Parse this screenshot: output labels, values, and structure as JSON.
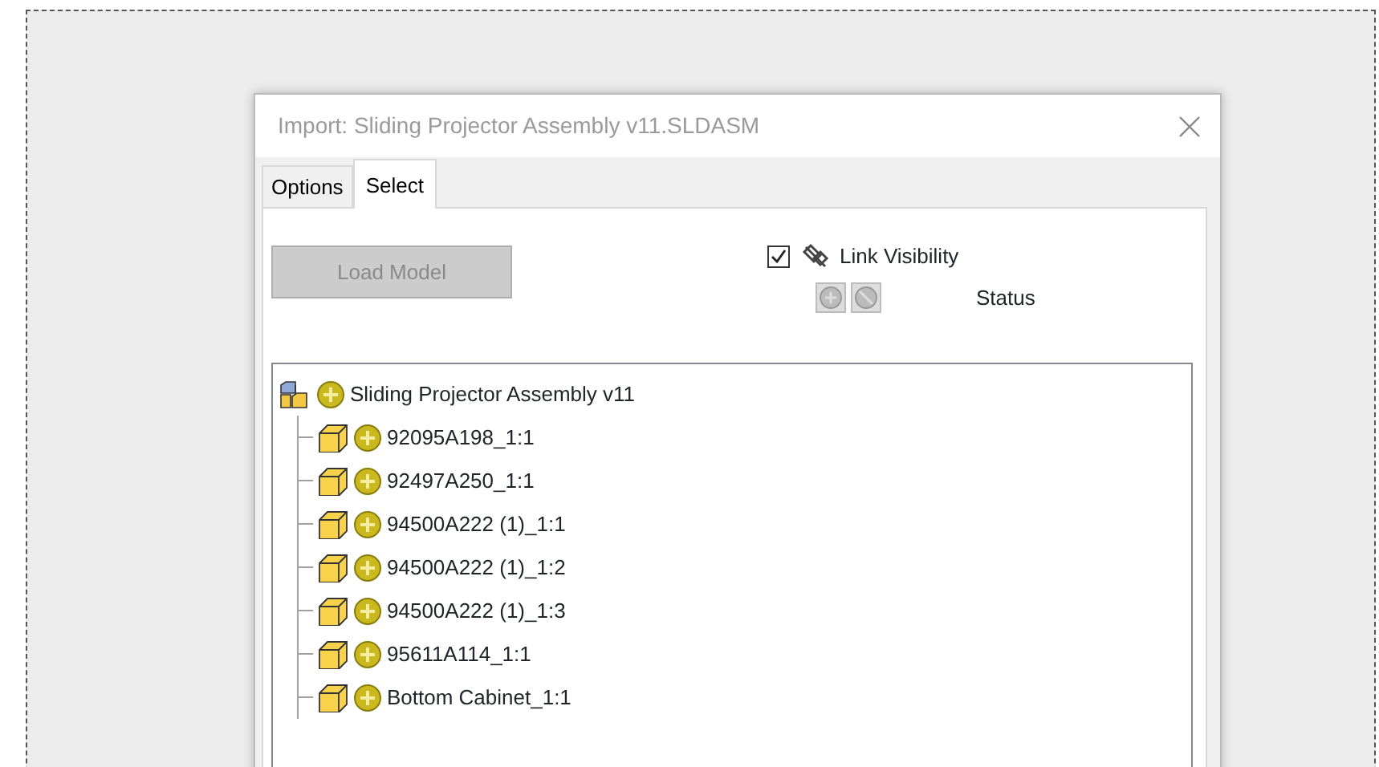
{
  "dialog": {
    "title": "Import: Sliding Projector Assembly v11.SLDASM",
    "tabs": [
      {
        "label": "Options",
        "selected": false
      },
      {
        "label": "Select",
        "selected": true
      }
    ],
    "link_visibility": {
      "label": "Link Visibility",
      "checked": true
    },
    "load_button": {
      "label": "Load Model",
      "disabled": true
    },
    "status": {
      "label": "Status"
    },
    "tree": {
      "label": "Sliding Projector Assembly v11",
      "kind": "assembly",
      "children": [
        {
          "label": "92095A198_1:1",
          "kind": "part"
        },
        {
          "label": "92497A250_1:1",
          "kind": "part"
        },
        {
          "label": "94500A222 (1)_1:1",
          "kind": "part"
        },
        {
          "label": "94500A222 (1)_1:2",
          "kind": "part"
        },
        {
          "label": "94500A222 (1)_1:3",
          "kind": "part"
        },
        {
          "label": "95611A114_1:1",
          "kind": "part"
        },
        {
          "label": "Bottom Cabinet_1:1",
          "kind": "part"
        }
      ]
    }
  }
}
